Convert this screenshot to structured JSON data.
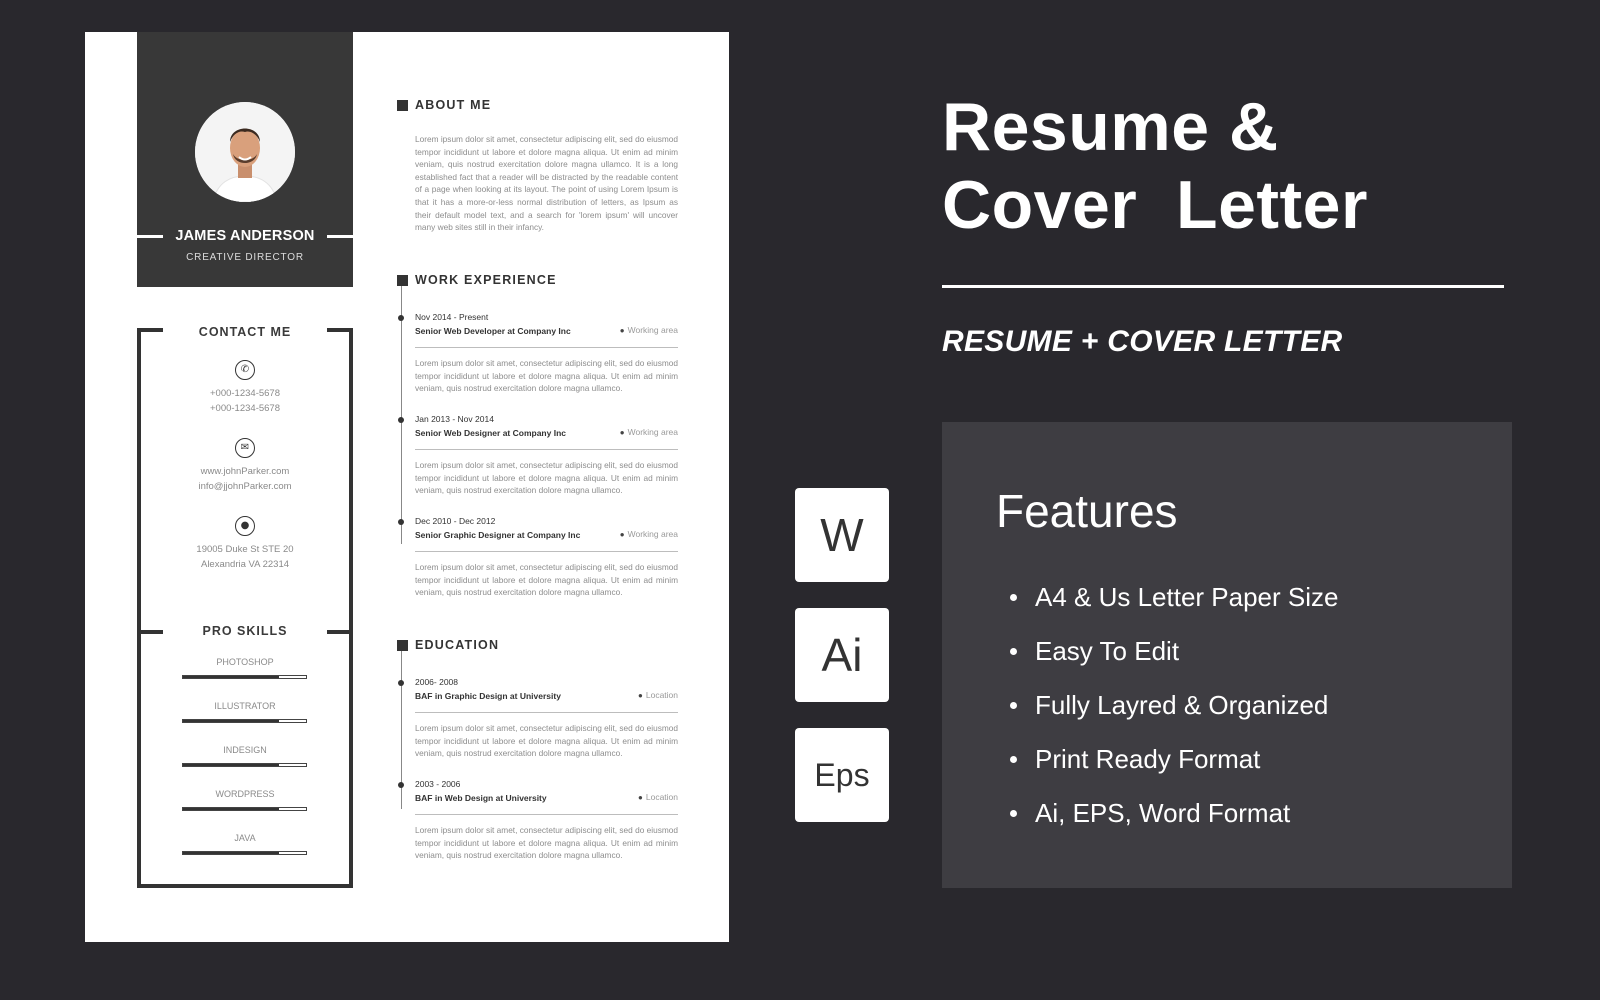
{
  "resume": {
    "name": "JAMES ANDERSON",
    "role": "CREATIVE DIRECTOR",
    "contact": {
      "heading": "CONTACT ME",
      "phone_icon": "phone-icon",
      "phones": [
        "+000-1234-5678",
        "+000-1234-5678"
      ],
      "mail_icon": "mail-icon",
      "web": [
        "www.johnParker.com",
        "info@jjohnParker.com"
      ],
      "location_icon": "location-pin-icon",
      "address": [
        "19005 Duke St STE 20",
        "Alexandria VA 22314"
      ]
    },
    "skills": {
      "heading": "PRO SKILLS",
      "items": [
        {
          "label": "PHOTOSHOP",
          "level": 0.78
        },
        {
          "label": "ILLUSTRATOR",
          "level": 0.78
        },
        {
          "label": "INDESIGN",
          "level": 0.78
        },
        {
          "label": "WORDPRESS",
          "level": 0.78
        },
        {
          "label": "JAVA",
          "level": 0.78
        }
      ]
    },
    "about": {
      "heading": "ABOUT ME",
      "text": "Lorem ipsum dolor sit amet, consectetur adipiscing elit, sed do eiusmod tempor incididunt ut labore et dolore magna aliqua. Ut enim ad minim veniam, quis nostrud exercitation dolore magna ullamco. It is a long established fact that a reader will be distracted by the readable content of a page when looking at its layout. The point of using Lorem Ipsum is that it has a more-or-less normal distribution of letters, as Ipsum as their default model text, and a search for 'lorem ipsum' will uncover many web sites still in their infancy."
    },
    "work": {
      "heading": "WORK EXPERIENCE",
      "entries": [
        {
          "date": "Nov 2014 - Present",
          "title": "Senior Web Developer at Company Inc",
          "location": "Working area",
          "text": "Lorem ipsum dolor sit amet, consectetur adipiscing elit, sed do eiusmod tempor incididunt ut labore et dolore magna aliqua. Ut enim ad minim veniam, quis nostrud exercitation dolore magna ullamco."
        },
        {
          "date": "Jan 2013 - Nov 2014",
          "title": "Senior Web Designer at Company Inc",
          "location": "Working area",
          "text": "Lorem ipsum dolor sit amet, consectetur adipiscing elit, sed do eiusmod tempor incididunt ut labore et dolore magna aliqua. Ut enim ad minim veniam, quis nostrud exercitation dolore magna ullamco."
        },
        {
          "date": "Dec 2010 - Dec 2012",
          "title": "Senior Graphic Designer at Company Inc",
          "location": "Working area",
          "text": "Lorem ipsum dolor sit amet, consectetur adipiscing elit, sed do eiusmod tempor incididunt ut labore et dolore magna aliqua. Ut enim ad minim veniam, quis nostrud exercitation dolore magna ullamco."
        }
      ]
    },
    "education": {
      "heading": "EDUCATION",
      "entries": [
        {
          "date": "2006- 2008",
          "title": "BAF in Graphic Design  at University",
          "location": "Location",
          "text": "Lorem ipsum dolor sit amet, consectetur adipiscing elit, sed do eiusmod tempor incididunt ut labore et dolore magna aliqua. Ut enim ad minim veniam, quis nostrud exercitation dolore magna ullamco."
        },
        {
          "date": "2003 - 2006",
          "title": "BAF in Web Design  at University",
          "location": "Location",
          "text": "Lorem ipsum dolor sit amet, consectetur adipiscing elit, sed do eiusmod tempor incididunt ut labore et dolore magna aliqua. Ut enim ad minim veniam, quis nostrud exercitation dolore magna ullamco."
        }
      ]
    }
  },
  "promo": {
    "title_line1": "Resume &",
    "title_line2": "Cover  Letter",
    "subtitle": "RESUME + COVER LETTER",
    "formats": [
      "W",
      "Ai",
      "Eps"
    ],
    "features_title": "Features",
    "features": [
      "A4  & Us Letter Paper Size",
      "Easy To Edit",
      "Fully Layred & Organized",
      "Print Ready Format",
      "Ai, EPS, Word Format"
    ]
  },
  "colors": {
    "background": "#29282d",
    "panel": "#3e3d42",
    "resume_dark": "#383838",
    "text_white": "#ffffff"
  }
}
